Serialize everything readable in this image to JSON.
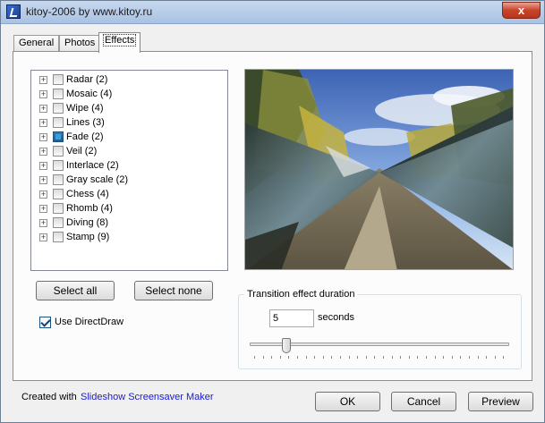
{
  "window": {
    "title": "kitoy-2006 by www.kitoy.ru",
    "close_glyph": "x"
  },
  "tabs": [
    {
      "label": "General",
      "active": false
    },
    {
      "label": "Photos",
      "active": false
    },
    {
      "label": "Effects",
      "active": true
    }
  ],
  "effects": [
    {
      "label": "Radar",
      "count": "(2)",
      "checked": false
    },
    {
      "label": "Mosaic",
      "count": "(4)",
      "checked": false
    },
    {
      "label": "Wipe",
      "count": "(4)",
      "checked": false
    },
    {
      "label": "Lines",
      "count": "(3)",
      "checked": false
    },
    {
      "label": "Fade",
      "count": "(2)",
      "checked": true
    },
    {
      "label": "Veil",
      "count": "(2)",
      "checked": false
    },
    {
      "label": "Interlace",
      "count": "(2)",
      "checked": false
    },
    {
      "label": "Gray scale",
      "count": "(2)",
      "checked": false
    },
    {
      "label": "Chess",
      "count": "(4)",
      "checked": false
    },
    {
      "label": "Rhomb",
      "count": "(4)",
      "checked": false
    },
    {
      "label": "Diving",
      "count": "(8)",
      "checked": false
    },
    {
      "label": "Stamp",
      "count": "(9)",
      "checked": false
    }
  ],
  "buttons": {
    "select_all": "Select all",
    "select_none": "Select none",
    "ok": "OK",
    "cancel": "Cancel",
    "preview": "Preview"
  },
  "directdraw": {
    "label": "Use DirectDraw",
    "checked": true
  },
  "duration": {
    "title": "Transition effect duration",
    "value": "5",
    "unit": "seconds",
    "slider_fraction": 0.14
  },
  "footer": {
    "created_with": "Created with",
    "link": "Slideshow Screensaver Maker"
  },
  "colors": {
    "link": "#1a1ad0",
    "fade_checkbox": "#2a7fb8"
  }
}
